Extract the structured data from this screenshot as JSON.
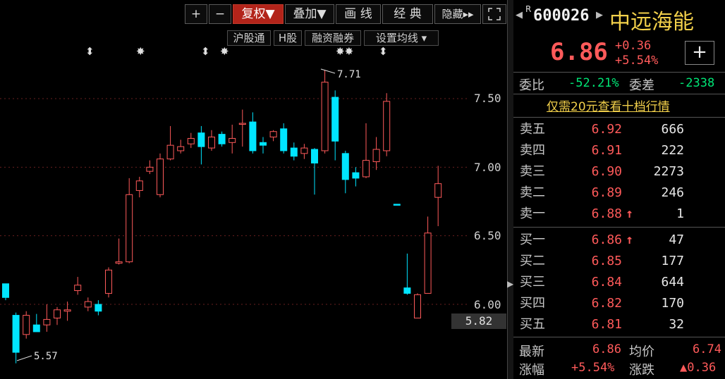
{
  "toolbar": {
    "plus": "+",
    "minus": "−",
    "fuquan": "复权▼",
    "diejia": "叠加▼",
    "huaxian": "画 线",
    "jingdian": "经 典",
    "yincang": "隐藏",
    "yincang_arrow": "▸▸",
    "fullscreen_icon": "fullscreen-icon"
  },
  "subtoolbar": {
    "hgt": "沪股通",
    "hgu": "H股",
    "rzrq": "融资融券",
    "szjx": "设置均线",
    "szjx_arrow": "▾"
  },
  "chart": {
    "high_label": "7.71",
    "low_label": "5.57",
    "current_price_tag": "5.82",
    "axis": [
      "7.50",
      "7.00",
      "6.50",
      "6.00"
    ]
  },
  "quote": {
    "nav_left": "◀",
    "nav_right": "▶",
    "r_mark": "R",
    "code": "600026",
    "name": "中远海能",
    "price": "6.86",
    "change": "+0.36",
    "pct": "+5.54%",
    "add": "+",
    "weibi_label": "委比",
    "weibi": "-52.21%",
    "weicha_label": "委差",
    "weicha": "-2338",
    "promo": "仅需20元查看十档行情"
  },
  "orderbook": {
    "sell": [
      {
        "label": "卖五",
        "price": "6.92",
        "arrow": "",
        "vol": "666"
      },
      {
        "label": "卖四",
        "price": "6.91",
        "arrow": "",
        "vol": "222"
      },
      {
        "label": "卖三",
        "price": "6.90",
        "arrow": "",
        "vol": "2273"
      },
      {
        "label": "卖二",
        "price": "6.89",
        "arrow": "",
        "vol": "246"
      },
      {
        "label": "卖一",
        "price": "6.88",
        "arrow": "↑",
        "vol": "1"
      }
    ],
    "buy": [
      {
        "label": "买一",
        "price": "6.86",
        "arrow": "↑",
        "vol": "47"
      },
      {
        "label": "买二",
        "price": "6.85",
        "arrow": "",
        "vol": "177"
      },
      {
        "label": "买三",
        "price": "6.84",
        "arrow": "",
        "vol": "644"
      },
      {
        "label": "买四",
        "price": "6.82",
        "arrow": "",
        "vol": "170"
      },
      {
        "label": "买五",
        "price": "6.81",
        "arrow": "",
        "vol": "32"
      }
    ]
  },
  "summary": {
    "latest_label": "最新",
    "latest": "6.86",
    "avg_label": "均价",
    "avg": "6.74",
    "pct_label": "涨幅",
    "pct": "+5.54%",
    "chg_label": "涨跌",
    "chg": "▲0.36"
  },
  "colors": {
    "up": "#ff5a5a",
    "down": "#00e5ff",
    "bg": "#000000",
    "active_btn": "#b3241a"
  },
  "chart_data": {
    "type": "candlestick",
    "ylim": [
      5.5,
      7.9
    ],
    "yticks": [
      6.0,
      6.5,
      7.0,
      7.5
    ],
    "candles": [
      {
        "o": 6.15,
        "h": 6.14,
        "l": 6.03,
        "c": 6.05,
        "dir": "down"
      },
      {
        "o": 5.92,
        "h": 5.94,
        "l": 5.57,
        "c": 5.65,
        "dir": "down"
      },
      {
        "o": 5.78,
        "h": 5.95,
        "l": 5.75,
        "c": 5.92,
        "dir": "up"
      },
      {
        "o": 5.85,
        "h": 5.93,
        "l": 5.82,
        "c": 5.8,
        "dir": "down"
      },
      {
        "o": 5.85,
        "h": 6.0,
        "l": 5.8,
        "c": 5.89,
        "dir": "up"
      },
      {
        "o": 5.9,
        "h": 5.98,
        "l": 5.85,
        "c": 5.96,
        "dir": "up"
      },
      {
        "o": 5.95,
        "h": 6.02,
        "l": 5.88,
        "c": 5.96,
        "dir": "up"
      },
      {
        "o": 6.1,
        "h": 6.2,
        "l": 6.07,
        "c": 6.14,
        "dir": "up"
      },
      {
        "o": 5.98,
        "h": 6.05,
        "l": 5.95,
        "c": 6.02,
        "dir": "up"
      },
      {
        "o": 6.0,
        "h": 6.03,
        "l": 5.92,
        "c": 5.95,
        "dir": "down"
      },
      {
        "o": 6.08,
        "h": 6.27,
        "l": 6.05,
        "c": 6.25,
        "dir": "up"
      },
      {
        "o": 6.3,
        "h": 6.48,
        "l": 6.29,
        "c": 6.31,
        "dir": "up"
      },
      {
        "o": 6.31,
        "h": 6.92,
        "l": 6.3,
        "c": 6.8,
        "dir": "up"
      },
      {
        "o": 6.83,
        "h": 6.93,
        "l": 6.78,
        "c": 6.9,
        "dir": "up"
      },
      {
        "o": 6.97,
        "h": 7.05,
        "l": 6.95,
        "c": 7.0,
        "dir": "up"
      },
      {
        "o": 6.8,
        "h": 7.1,
        "l": 6.78,
        "c": 7.06,
        "dir": "up"
      },
      {
        "o": 7.06,
        "h": 7.3,
        "l": 7.05,
        "c": 7.16,
        "dir": "up"
      },
      {
        "o": 7.12,
        "h": 7.2,
        "l": 7.1,
        "c": 7.15,
        "dir": "up"
      },
      {
        "o": 7.17,
        "h": 7.25,
        "l": 7.14,
        "c": 7.21,
        "dir": "up"
      },
      {
        "o": 7.25,
        "h": 7.3,
        "l": 7.02,
        "c": 7.15,
        "dir": "down"
      },
      {
        "o": 7.14,
        "h": 7.27,
        "l": 7.12,
        "c": 7.22,
        "dir": "up"
      },
      {
        "o": 7.24,
        "h": 7.26,
        "l": 7.15,
        "c": 7.17,
        "dir": "down"
      },
      {
        "o": 7.18,
        "h": 7.31,
        "l": 7.1,
        "c": 7.21,
        "dir": "up"
      },
      {
        "o": 7.32,
        "h": 7.42,
        "l": 7.15,
        "c": 7.32,
        "dir": "up"
      },
      {
        "o": 7.33,
        "h": 7.4,
        "l": 7.1,
        "c": 7.12,
        "dir": "down"
      },
      {
        "o": 7.18,
        "h": 7.22,
        "l": 7.1,
        "c": 7.16,
        "dir": "down"
      },
      {
        "o": 7.22,
        "h": 7.27,
        "l": 7.19,
        "c": 7.26,
        "dir": "up"
      },
      {
        "o": 7.28,
        "h": 7.32,
        "l": 7.1,
        "c": 7.12,
        "dir": "down"
      },
      {
        "o": 7.14,
        "h": 7.18,
        "l": 7.05,
        "c": 7.08,
        "dir": "down"
      },
      {
        "o": 7.1,
        "h": 7.17,
        "l": 7.06,
        "c": 7.14,
        "dir": "up"
      },
      {
        "o": 7.13,
        "h": 7.14,
        "l": 6.8,
        "c": 7.03,
        "dir": "down"
      },
      {
        "o": 7.12,
        "h": 7.71,
        "l": 7.1,
        "c": 7.62,
        "dir": "up"
      },
      {
        "o": 7.51,
        "h": 7.56,
        "l": 7.05,
        "c": 7.19,
        "dir": "down"
      },
      {
        "o": 7.1,
        "h": 7.12,
        "l": 6.81,
        "c": 6.91,
        "dir": "down"
      },
      {
        "o": 6.96,
        "h": 7.0,
        "l": 6.86,
        "c": 6.92,
        "dir": "down"
      },
      {
        "o": 6.93,
        "h": 7.32,
        "l": 6.92,
        "c": 7.05,
        "dir": "up"
      },
      {
        "o": 7.04,
        "h": 7.22,
        "l": 6.98,
        "c": 7.13,
        "dir": "up"
      },
      {
        "o": 7.12,
        "h": 7.54,
        "l": 7.08,
        "c": 7.48,
        "dir": "up"
      },
      {
        "o": 6.73,
        "h": 6.73,
        "l": 6.73,
        "c": 6.73,
        "dir": "down"
      },
      {
        "o": 6.12,
        "h": 6.37,
        "l": 6.07,
        "c": 6.08,
        "dir": "down"
      },
      {
        "o": 5.9,
        "h": 6.08,
        "l": 5.9,
        "c": 6.07,
        "dir": "up"
      },
      {
        "o": 6.08,
        "h": 6.64,
        "l": 6.08,
        "c": 6.52,
        "dir": "up"
      },
      {
        "o": 6.78,
        "h": 7.01,
        "l": 6.57,
        "c": 6.88,
        "dir": "up"
      }
    ]
  }
}
